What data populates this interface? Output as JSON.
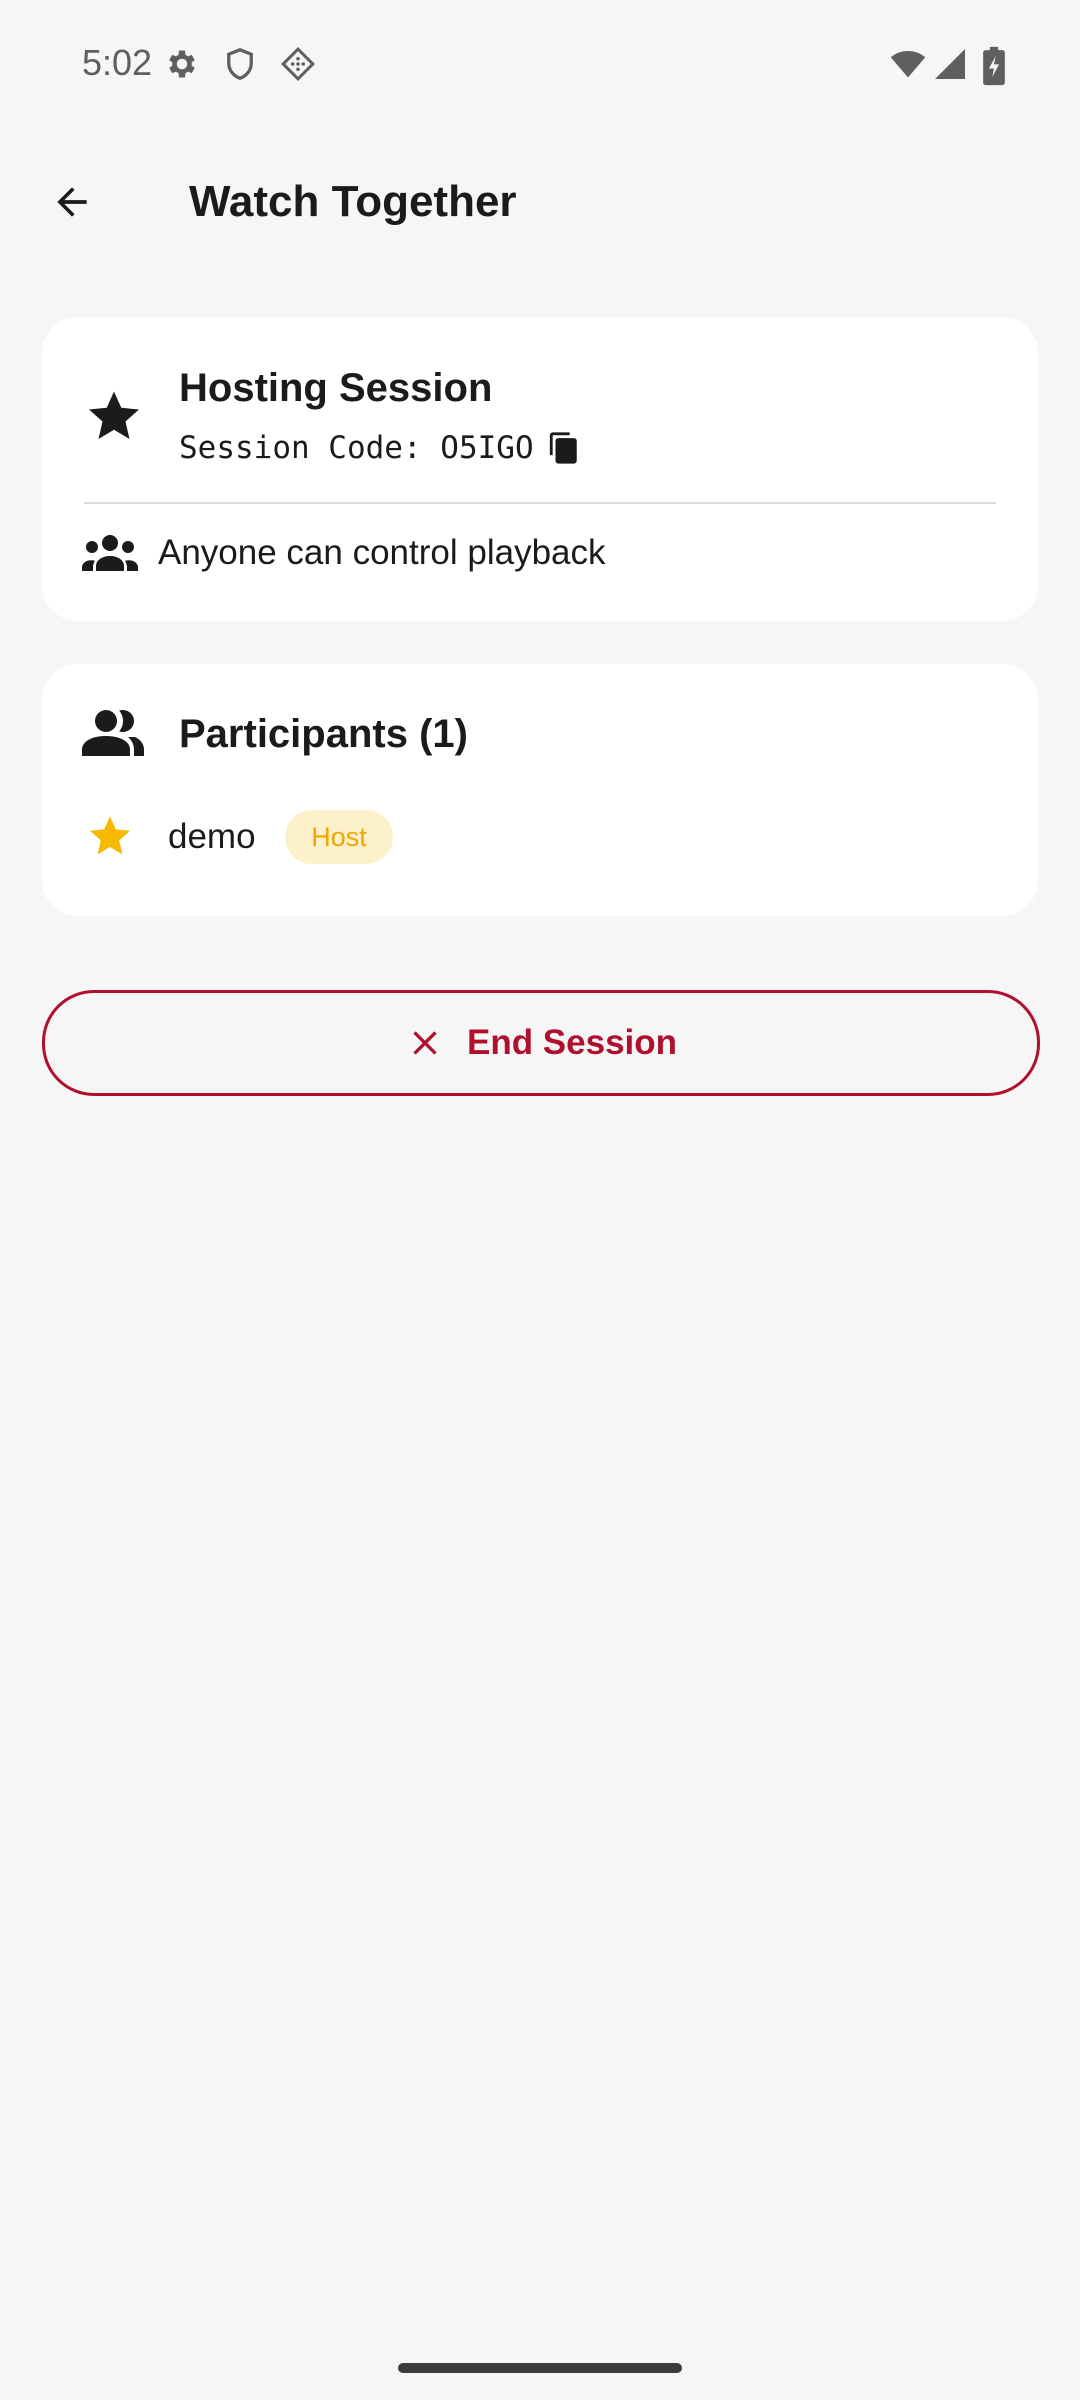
{
  "status_bar": {
    "time": "5:02",
    "left_icons": [
      "settings-icon",
      "shield-icon",
      "diamond-dots-icon"
    ],
    "right_icons": [
      "wifi-icon",
      "cell-signal-icon",
      "battery-charging-icon"
    ]
  },
  "app_bar": {
    "back_icon": "arrow-left-icon",
    "title": "Watch Together"
  },
  "host_card": {
    "icon": "star-icon",
    "title": "Hosting Session",
    "code_prefix": "Session Code: ",
    "code_value": "O5IGO",
    "copy_icon": "copy-icon",
    "control_icon": "group-icon",
    "control_text": "Anyone can control playback"
  },
  "participants_card": {
    "icon": "people-icon",
    "title": "Participants (1)",
    "participants": [
      {
        "name": "demo",
        "icon": "star-icon",
        "badge": "Host"
      }
    ]
  },
  "end_button": {
    "icon": "close-icon",
    "label": "End Session"
  },
  "colors": {
    "background": "#f6f6f6",
    "card": "#ffffff",
    "danger": "#b0102d",
    "host_star": "#f6b800",
    "badge_bg": "#fdf1cc",
    "badge_text": "#f0a500"
  }
}
